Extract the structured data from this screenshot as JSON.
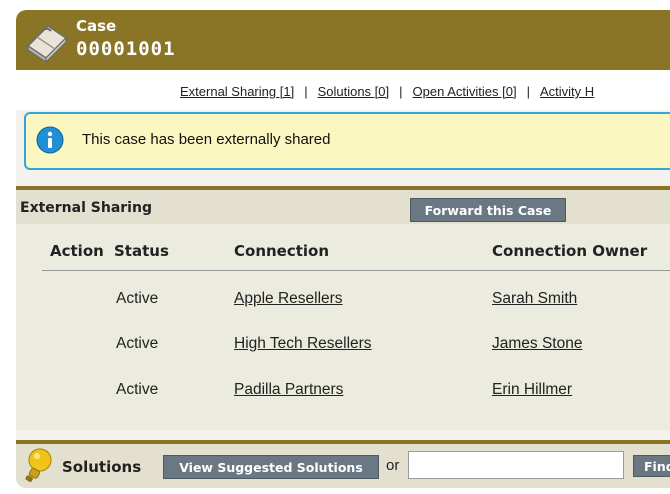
{
  "header": {
    "label": "Case",
    "case_number": "00001001"
  },
  "links": [
    {
      "label": "External Sharing [1]"
    },
    {
      "label": "Solutions [0]"
    },
    {
      "label": "Open Activities [0]"
    },
    {
      "label": "Activity H"
    }
  ],
  "links_separator": "|",
  "banner": {
    "message": "This case has been externally shared",
    "icon": "info-icon"
  },
  "external_sharing": {
    "title": "External Sharing",
    "forward_button": "Forward this Case",
    "columns": [
      "Action",
      "Status",
      "Connection",
      "Connection Owner"
    ],
    "rows": [
      {
        "action": "",
        "status": "Active",
        "connection": "Apple Resellers",
        "owner": "Sarah Smith"
      },
      {
        "action": "",
        "status": "Active",
        "connection": "High Tech Resellers",
        "owner": "James Stone"
      },
      {
        "action": "",
        "status": "Active",
        "connection": "Padilla Partners",
        "owner": "Erin Hillmer"
      }
    ]
  },
  "solutions": {
    "title": "Solutions",
    "suggest_button": "View Suggested Solutions",
    "or_text": "or",
    "search_value": "",
    "find_button": "Find"
  },
  "colors": {
    "header_brown": "#8a7527",
    "banner_yellow": "#fbf7c0",
    "banner_border": "#38a3d6",
    "button_gray": "#6a7884"
  }
}
